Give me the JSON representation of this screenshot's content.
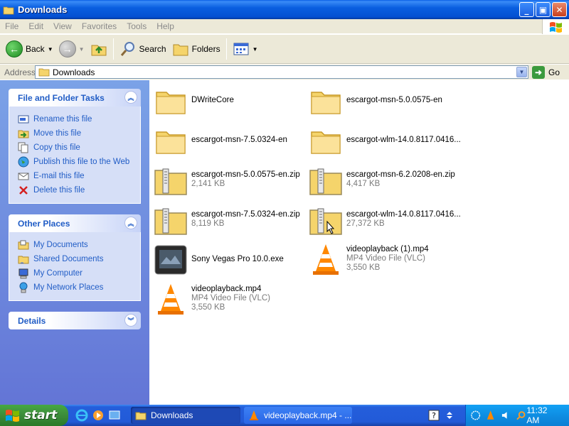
{
  "window": {
    "title": "Downloads"
  },
  "menu": [
    "File",
    "Edit",
    "View",
    "Favorites",
    "Tools",
    "Help"
  ],
  "toolbar": {
    "back": "Back",
    "search": "Search",
    "folders": "Folders"
  },
  "address": {
    "label": "Address",
    "value": "Downloads",
    "go": "Go"
  },
  "tasks": {
    "title": "File and Folder Tasks",
    "items": [
      "Rename this file",
      "Move this file",
      "Copy this file",
      "Publish this file to the Web",
      "E-mail this file",
      "Delete this file"
    ]
  },
  "places": {
    "title": "Other Places",
    "items": [
      "My Documents",
      "Shared Documents",
      "My Computer",
      "My Network Places"
    ]
  },
  "details": {
    "title": "Details"
  },
  "files": [
    {
      "name": "DWriteCore",
      "type": "folder"
    },
    {
      "name": "escargot-msn-5.0.0575-en",
      "type": "folder"
    },
    {
      "name": "escargot-msn-7.5.0324-en",
      "type": "folder"
    },
    {
      "name": "escargot-wlm-14.0.8117.0416...",
      "type": "folder"
    },
    {
      "name": "escargot-msn-5.0.0575-en.zip",
      "size": "2,141 KB",
      "type": "zip"
    },
    {
      "name": "escargot-msn-6.2.0208-en.zip",
      "size": "4,417 KB",
      "type": "zip"
    },
    {
      "name": "escargot-msn-7.5.0324-en.zip",
      "size": "8,119 KB",
      "type": "zip"
    },
    {
      "name": "escargot-wlm-14.0.8117.0416...",
      "size": "27,372 KB",
      "type": "zip"
    },
    {
      "name": "Sony Vegas Pro 10.0.exe",
      "type": "exe"
    },
    {
      "name": "videoplayback (1).mp4",
      "kind": "MP4 Video File (VLC)",
      "size": "3,550 KB",
      "type": "vlc"
    },
    {
      "name": "videoplayback.mp4",
      "kind": "MP4 Video File (VLC)",
      "size": "3,550 KB",
      "type": "vlc"
    }
  ],
  "taskbar": {
    "start": "start",
    "tasks": [
      "Downloads",
      "videoplayback.mp4 - ..."
    ],
    "clock": "11:32 AM"
  },
  "colors": {
    "titlebar": "#0a5fe0",
    "taskpane": "#7ba2e7",
    "link": "#215dc6",
    "start": "#3c8c3a"
  }
}
